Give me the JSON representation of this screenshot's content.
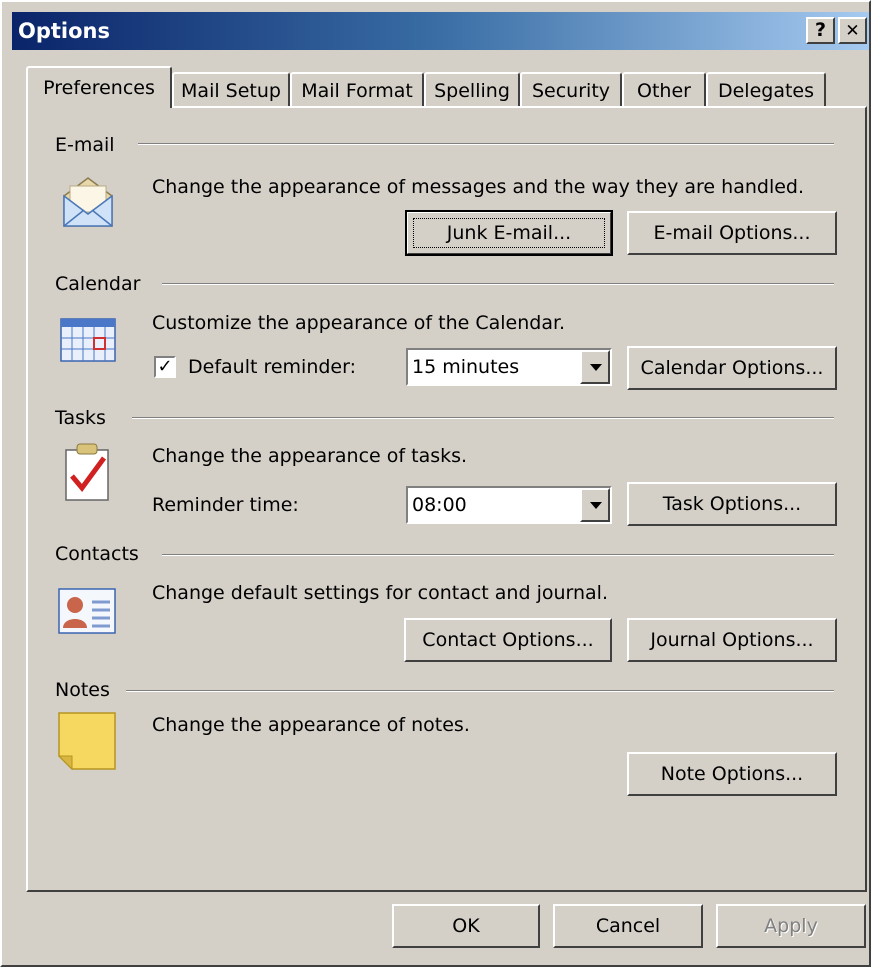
{
  "window": {
    "title": "Options",
    "help_glyph": "?",
    "close_glyph": "✕"
  },
  "tabs": [
    {
      "label": "Preferences",
      "active": true
    },
    {
      "label": "Mail Setup"
    },
    {
      "label": "Mail Format"
    },
    {
      "label": "Spelling"
    },
    {
      "label": "Security"
    },
    {
      "label": "Other"
    },
    {
      "label": "Delegates"
    }
  ],
  "email": {
    "title": "E-mail",
    "description": "Change the appearance of messages and the way they are handled.",
    "junk_button": "Junk E-mail...",
    "options_button": "E-mail Options..."
  },
  "calendar": {
    "title": "Calendar",
    "description": "Customize the appearance of the Calendar.",
    "reminder_label": "Default reminder:",
    "reminder_checked": true,
    "reminder_value": "15 minutes",
    "options_button": "Calendar Options..."
  },
  "tasks": {
    "title": "Tasks",
    "description": "Change the appearance of tasks.",
    "reminder_label": "Reminder time:",
    "reminder_value": "08:00",
    "options_button": "Task Options..."
  },
  "contacts": {
    "title": "Contacts",
    "description": "Change default settings for contact and journal.",
    "contact_button": "Contact Options...",
    "journal_button": "Journal Options..."
  },
  "notes": {
    "title": "Notes",
    "description": "Change the appearance of notes.",
    "options_button": "Note Options..."
  },
  "footer": {
    "ok": "OK",
    "cancel": "Cancel",
    "apply": "Apply"
  }
}
